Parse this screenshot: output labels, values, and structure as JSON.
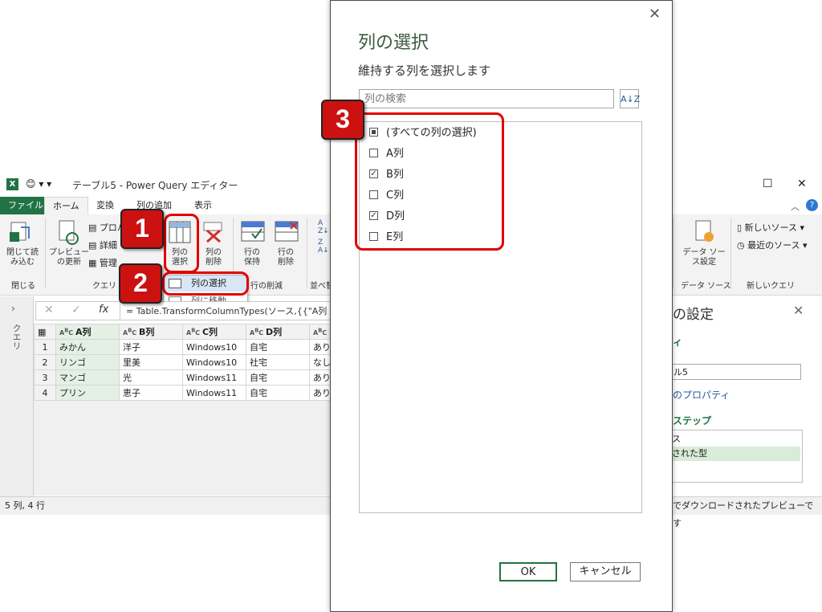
{
  "window": {
    "quick_access": "😊 ▾  ▾",
    "title": "テーブル5 - Power Query エディター",
    "controls": {
      "minimize": "—",
      "maximize": "☐",
      "close": "✕"
    }
  },
  "ribbon_tabs": [
    "ファイル",
    "ホーム",
    "変換",
    "列の追加",
    "表示"
  ],
  "ribbon": {
    "close_load": "閉じて読\nみ込む",
    "preview_refresh": "プレビュー\nの更新",
    "properties": "プロパ",
    "advanced": "詳細",
    "manage": "管理",
    "choose_columns": "列の\n選択",
    "remove_columns": "列の\n削除",
    "keep_rows": "行の\n保持",
    "remove_rows": "行の\n削除",
    "group_close": "閉じる",
    "group_query": "クエリ",
    "group_reduce_rows": "行の削減",
    "group_sort": "並べ替",
    "datasource_settings": "データ ソー\nス設定",
    "group_datasource": "データ ソース",
    "new_source": "新しいソース",
    "recent_sources": "最近のソース",
    "group_new_query": "新しいクエリ",
    "dropdown_choose": "列の選択",
    "dropdown_goto": "列に移動"
  },
  "formula": "= Table.TransformColumnTypes(ソース,{{\"A列",
  "queries_label": "クエリ",
  "grid": {
    "headers": [
      "A列",
      "B列",
      "C列",
      "D列",
      ""
    ],
    "rows": [
      [
        "1",
        "みかん",
        "洋子",
        "Windows10",
        "自宅",
        "あり"
      ],
      [
        "2",
        "リンゴ",
        "里美",
        "Windows10",
        "社宅",
        "なし"
      ],
      [
        "3",
        "マンゴ",
        "光",
        "Windows11",
        "自宅",
        "あり"
      ],
      [
        "4",
        "プリン",
        "恵子",
        "Windows11",
        "自宅",
        "あり"
      ]
    ]
  },
  "status": {
    "left": "5 列, 4 行",
    "right": "でダウンロードされたプレビューです"
  },
  "settings_pane": {
    "title": "の設定",
    "props_header": "ィ",
    "name_value": "ル5",
    "all_props": "のプロパティ",
    "steps_header": "ステップ",
    "step1": "ス",
    "step2": "された型"
  },
  "dialog": {
    "title": "列の選択",
    "subtitle": "維持する列を選択します",
    "search_placeholder": "列の検索",
    "items": [
      {
        "label": "(すべての列の選択)",
        "state": "partial"
      },
      {
        "label": "A列",
        "state": "unchecked"
      },
      {
        "label": "B列",
        "state": "checked"
      },
      {
        "label": "C列",
        "state": "unchecked"
      },
      {
        "label": "D列",
        "state": "checked"
      },
      {
        "label": "E列",
        "state": "unchecked"
      }
    ],
    "ok": "OK",
    "cancel": "キャンセル"
  },
  "callouts": [
    "1",
    "2",
    "3"
  ],
  "colors": {
    "accent": "#217346",
    "callout": "#cc1111",
    "frame": "#e00000"
  }
}
